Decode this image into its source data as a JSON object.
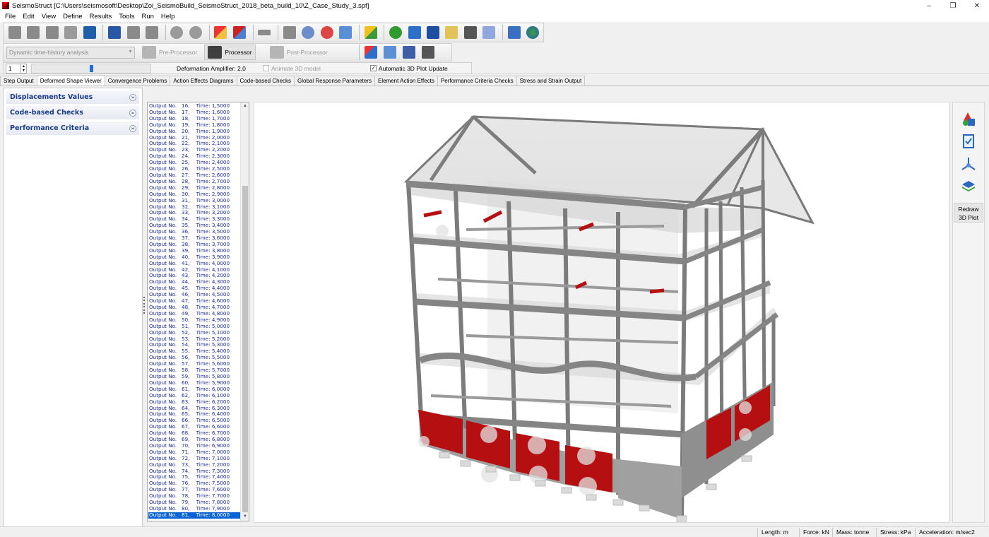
{
  "window": {
    "title": "SeismoStruct   [C:\\Users\\seismosoft\\Desktop\\Zoi_SeismoBuild_SeismoStruct_2018_beta_build_10\\Z_Case_Study_3.spf]",
    "controls": {
      "minimize": "–",
      "maximize": "❐",
      "close": "✕"
    }
  },
  "menu": [
    "File",
    "Edit",
    "View",
    "Define",
    "Results",
    "Tools",
    "Run",
    "Help"
  ],
  "toolbar": {
    "icons": [
      "new-icon",
      "open-icon",
      "close-file-icon",
      "wrench-icon",
      "save-icon",
      "report-icon",
      "copy-icon",
      "paste-icon",
      "undo-icon",
      "redo-icon",
      "building-modeller-icon",
      "model-wizard-icon",
      "connect-icon",
      "stop-icon",
      "gear-icon",
      "settings-icon",
      "calculator-icon",
      "eraser-icon",
      "help-icon",
      "book-icon",
      "manual-icon",
      "frame-icon",
      "video-icon",
      "link-icon",
      "edit-icon",
      "globe-icon"
    ],
    "analysis_type": "Dynamic time-history analysis",
    "pre_processor_label": "Pre-Processor",
    "processor_label": "Processor",
    "post_processor_label": "Post-Processor",
    "step_value": "1",
    "slider_percent": 50,
    "amplifier_text": "Deformation Amplifier: 2,0",
    "animate_label": "Animate 3D model",
    "animate_checked": false,
    "autoupdate_label": "Automatic 3D Plot Update",
    "autoupdate_checked": true
  },
  "tabs": [
    "Step Output",
    "Deformed Shape Viewer",
    "Convergence Problems",
    "Action Effects Diagrams",
    "Code-based Checks",
    "Global Response Parameters",
    "Element Action Effects",
    "Performance Criteria Checks",
    "Stress and Strain Output"
  ],
  "active_tab": "Deformed Shape Viewer",
  "left_panel": {
    "sections": [
      {
        "label": "Displacements Values",
        "chevron": "»"
      },
      {
        "label": "Code-based Checks",
        "chevron": "»"
      },
      {
        "label": "Performance Criteria",
        "chevron": "»"
      }
    ]
  },
  "output_list": {
    "items": [
      "Output No.   16,    Time: 1,5000",
      "Output No.   17,    Time: 1,6000",
      "Output No.   18,    Time: 1,7000",
      "Output No.   19,    Time: 1,8000",
      "Output No.   20,    Time: 1,9000",
      "Output No.   21,    Time: 2,0000",
      "Output No.   22,    Time: 2,1000",
      "Output No.   23,    Time: 2,2000",
      "Output No.   24,    Time: 2,3000",
      "Output No.   25,    Time: 2,4000",
      "Output No.   26,    Time: 2,5000",
      "Output No.   27,    Time: 2,6000",
      "Output No.   28,    Time: 2,7000",
      "Output No.   29,    Time: 2,8000",
      "Output No.   30,    Time: 2,9000",
      "Output No.   31,    Time: 3,0000",
      "Output No.   32,    Time: 3,1000",
      "Output No.   33,    Time: 3,2000",
      "Output No.   34,    Time: 3,3000",
      "Output No.   35,    Time: 3,4000",
      "Output No.   36,    Time: 3,5000",
      "Output No.   37,    Time: 3,6000",
      "Output No.   38,    Time: 3,7000",
      "Output No.   39,    Time: 3,8000",
      "Output No.   40,    Time: 3,9000",
      "Output No.   41,    Time: 4,0000",
      "Output No.   42,    Time: 4,1000",
      "Output No.   43,    Time: 4,2000",
      "Output No.   44,    Time: 4,3000",
      "Output No.   45,    Time: 4,4000",
      "Output No.   46,    Time: 4,5000",
      "Output No.   47,    Time: 4,6000",
      "Output No.   48,    Time: 4,7000",
      "Output No.   49,    Time: 4,8000",
      "Output No.   50,    Time: 4,9000",
      "Output No.   51,    Time: 5,0000",
      "Output No.   52,    Time: 5,1000",
      "Output No.   53,    Time: 5,2000",
      "Output No.   54,    Time: 5,3000",
      "Output No.   55,    Time: 5,4000",
      "Output No.   56,    Time: 5,5000",
      "Output No.   57,    Time: 5,6000",
      "Output No.   58,    Time: 5,7000",
      "Output No.   59,    Time: 5,8000",
      "Output No.   60,    Time: 5,9000",
      "Output No.   61,    Time: 6,0000",
      "Output No.   62,    Time: 6,1000",
      "Output No.   63,    Time: 6,2000",
      "Output No.   64,    Time: 6,3000",
      "Output No.   65,    Time: 6,4000",
      "Output No.   66,    Time: 6,5000",
      "Output No.   67,    Time: 6,6000",
      "Output No.   68,    Time: 6,7000",
      "Output No.   69,    Time: 6,8000",
      "Output No.   70,    Time: 6,9000",
      "Output No.   71,    Time: 7,0000",
      "Output No.   72,    Time: 7,1000",
      "Output No.   73,    Time: 7,2000",
      "Output No.   74,    Time: 7,3000",
      "Output No.   75,    Time: 7,4000",
      "Output No.   76,    Time: 7,5000",
      "Output No.   77,    Time: 7,6000",
      "Output No.   78,    Time: 7,7000",
      "Output No.   79,    Time: 7,8000",
      "Output No.   80,    Time: 7,9000",
      "Output No.   81,    Time: 8,0000"
    ],
    "selected_index": 65
  },
  "right_tools": {
    "icons": [
      "shapes-icon",
      "checklist-icon",
      "axes-icon",
      "layers-icon"
    ],
    "redraw_line1": "Redraw",
    "redraw_line2": "3D Plot"
  },
  "status_bar": {
    "length": "Length: m",
    "force": "Force: kN",
    "mass": "Mass: tonne",
    "stress": "Stress: kPa",
    "acceleration": "Acceleration: m/sec2"
  },
  "colors": {
    "accent": "#0a64d6",
    "list_text": "#1a2a9c",
    "section_header_text": "#1a3c8a",
    "damaged_element": "#b50f12",
    "structure_grey": "#7d7d7d"
  }
}
